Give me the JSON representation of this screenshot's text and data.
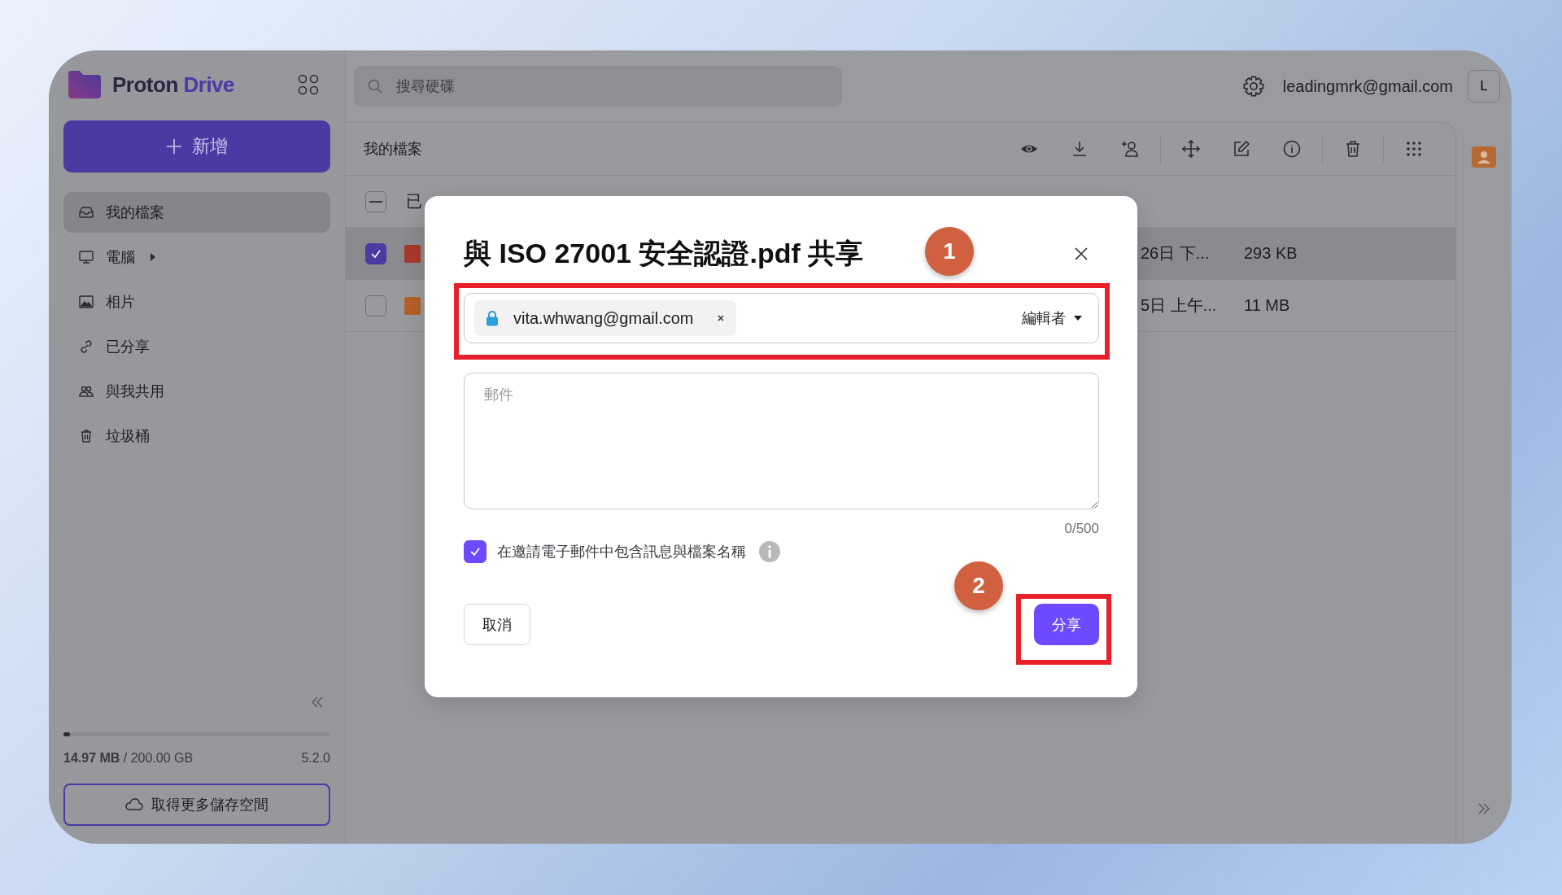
{
  "app": {
    "logo_text": "Proton",
    "logo_accent": "Drive",
    "new_button": "新增"
  },
  "sidebar": {
    "items": [
      {
        "label": "我的檔案",
        "selected": true,
        "has_submenu": false
      },
      {
        "label": "電腦",
        "selected": false,
        "has_submenu": true
      },
      {
        "label": "相片",
        "selected": false,
        "has_submenu": false
      },
      {
        "label": "已分享",
        "selected": false,
        "has_submenu": false
      },
      {
        "label": "與我共用",
        "selected": false,
        "has_submenu": false
      },
      {
        "label": "垃圾桶",
        "selected": false,
        "has_submenu": false
      }
    ]
  },
  "storage": {
    "level": 0.02,
    "usage": "**14.97 MB** / 200.00 GB",
    "version": "5.2.0",
    "button": "取得更多儲存空間"
  },
  "topbar": {
    "search_placeholder": "搜尋硬碟",
    "email": "leadingmrk@gmail.com",
    "avatar": "L"
  },
  "files": {
    "title": "我的檔案",
    "select_all_indeterminate": true,
    "header_label": "已",
    "rows": [
      {
        "selected": true,
        "color": "#a8392c",
        "date": "26日 下...",
        "size": "293 KB"
      },
      {
        "selected": false,
        "color": "#b5602a",
        "date": "5日 上午...",
        "size": "11 MB"
      }
    ]
  },
  "dialog": {
    "title": "與 ISO 27001 安全認證.pdf 共享",
    "recipient": "vita.whwang@gmail.com",
    "role": "編輯者",
    "message_placeholder": "郵件",
    "counter": "0/500",
    "include_label": "在邀請電子郵件中包含訊息與檔案名稱",
    "include_checked": true,
    "cancel": "取消",
    "share": "分享"
  },
  "annotations": [
    {
      "label": "1"
    },
    {
      "label": "2"
    }
  ]
}
